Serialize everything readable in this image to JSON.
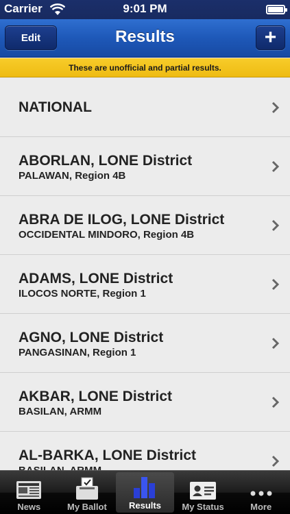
{
  "status_bar": {
    "carrier": "Carrier",
    "time": "9:01 PM"
  },
  "nav": {
    "title": "Results",
    "edit_label": "Edit",
    "add_label": "+"
  },
  "banner": {
    "text": "These are unofficial and partial results."
  },
  "list": {
    "items": [
      {
        "title": "NATIONAL",
        "subtitle": ""
      },
      {
        "title": "ABORLAN, LONE District",
        "subtitle": "PALAWAN, Region 4B"
      },
      {
        "title": "ABRA DE ILOG, LONE District",
        "subtitle": "OCCIDENTAL MINDORO, Region 4B"
      },
      {
        "title": "ADAMS, LONE District",
        "subtitle": "ILOCOS NORTE, Region 1"
      },
      {
        "title": "AGNO, LONE District",
        "subtitle": "PANGASINAN, Region 1"
      },
      {
        "title": "AKBAR, LONE District",
        "subtitle": "BASILAN, ARMM"
      },
      {
        "title": "AL-BARKA, LONE District",
        "subtitle": "BASILAN, ARMM"
      }
    ]
  },
  "tabs": [
    {
      "label": "News",
      "icon": "newspaper-icon"
    },
    {
      "label": "My Ballot",
      "icon": "ballot-box-icon"
    },
    {
      "label": "Results",
      "icon": "bar-chart-icon",
      "selected": true
    },
    {
      "label": "My Status",
      "icon": "id-card-icon"
    },
    {
      "label": "More",
      "icon": "more-dots-icon"
    }
  ],
  "colors": {
    "nav_blue": "#1e58b8",
    "banner_yellow": "#f3c31c",
    "selected_tab_blue": "#2a3fd6"
  }
}
